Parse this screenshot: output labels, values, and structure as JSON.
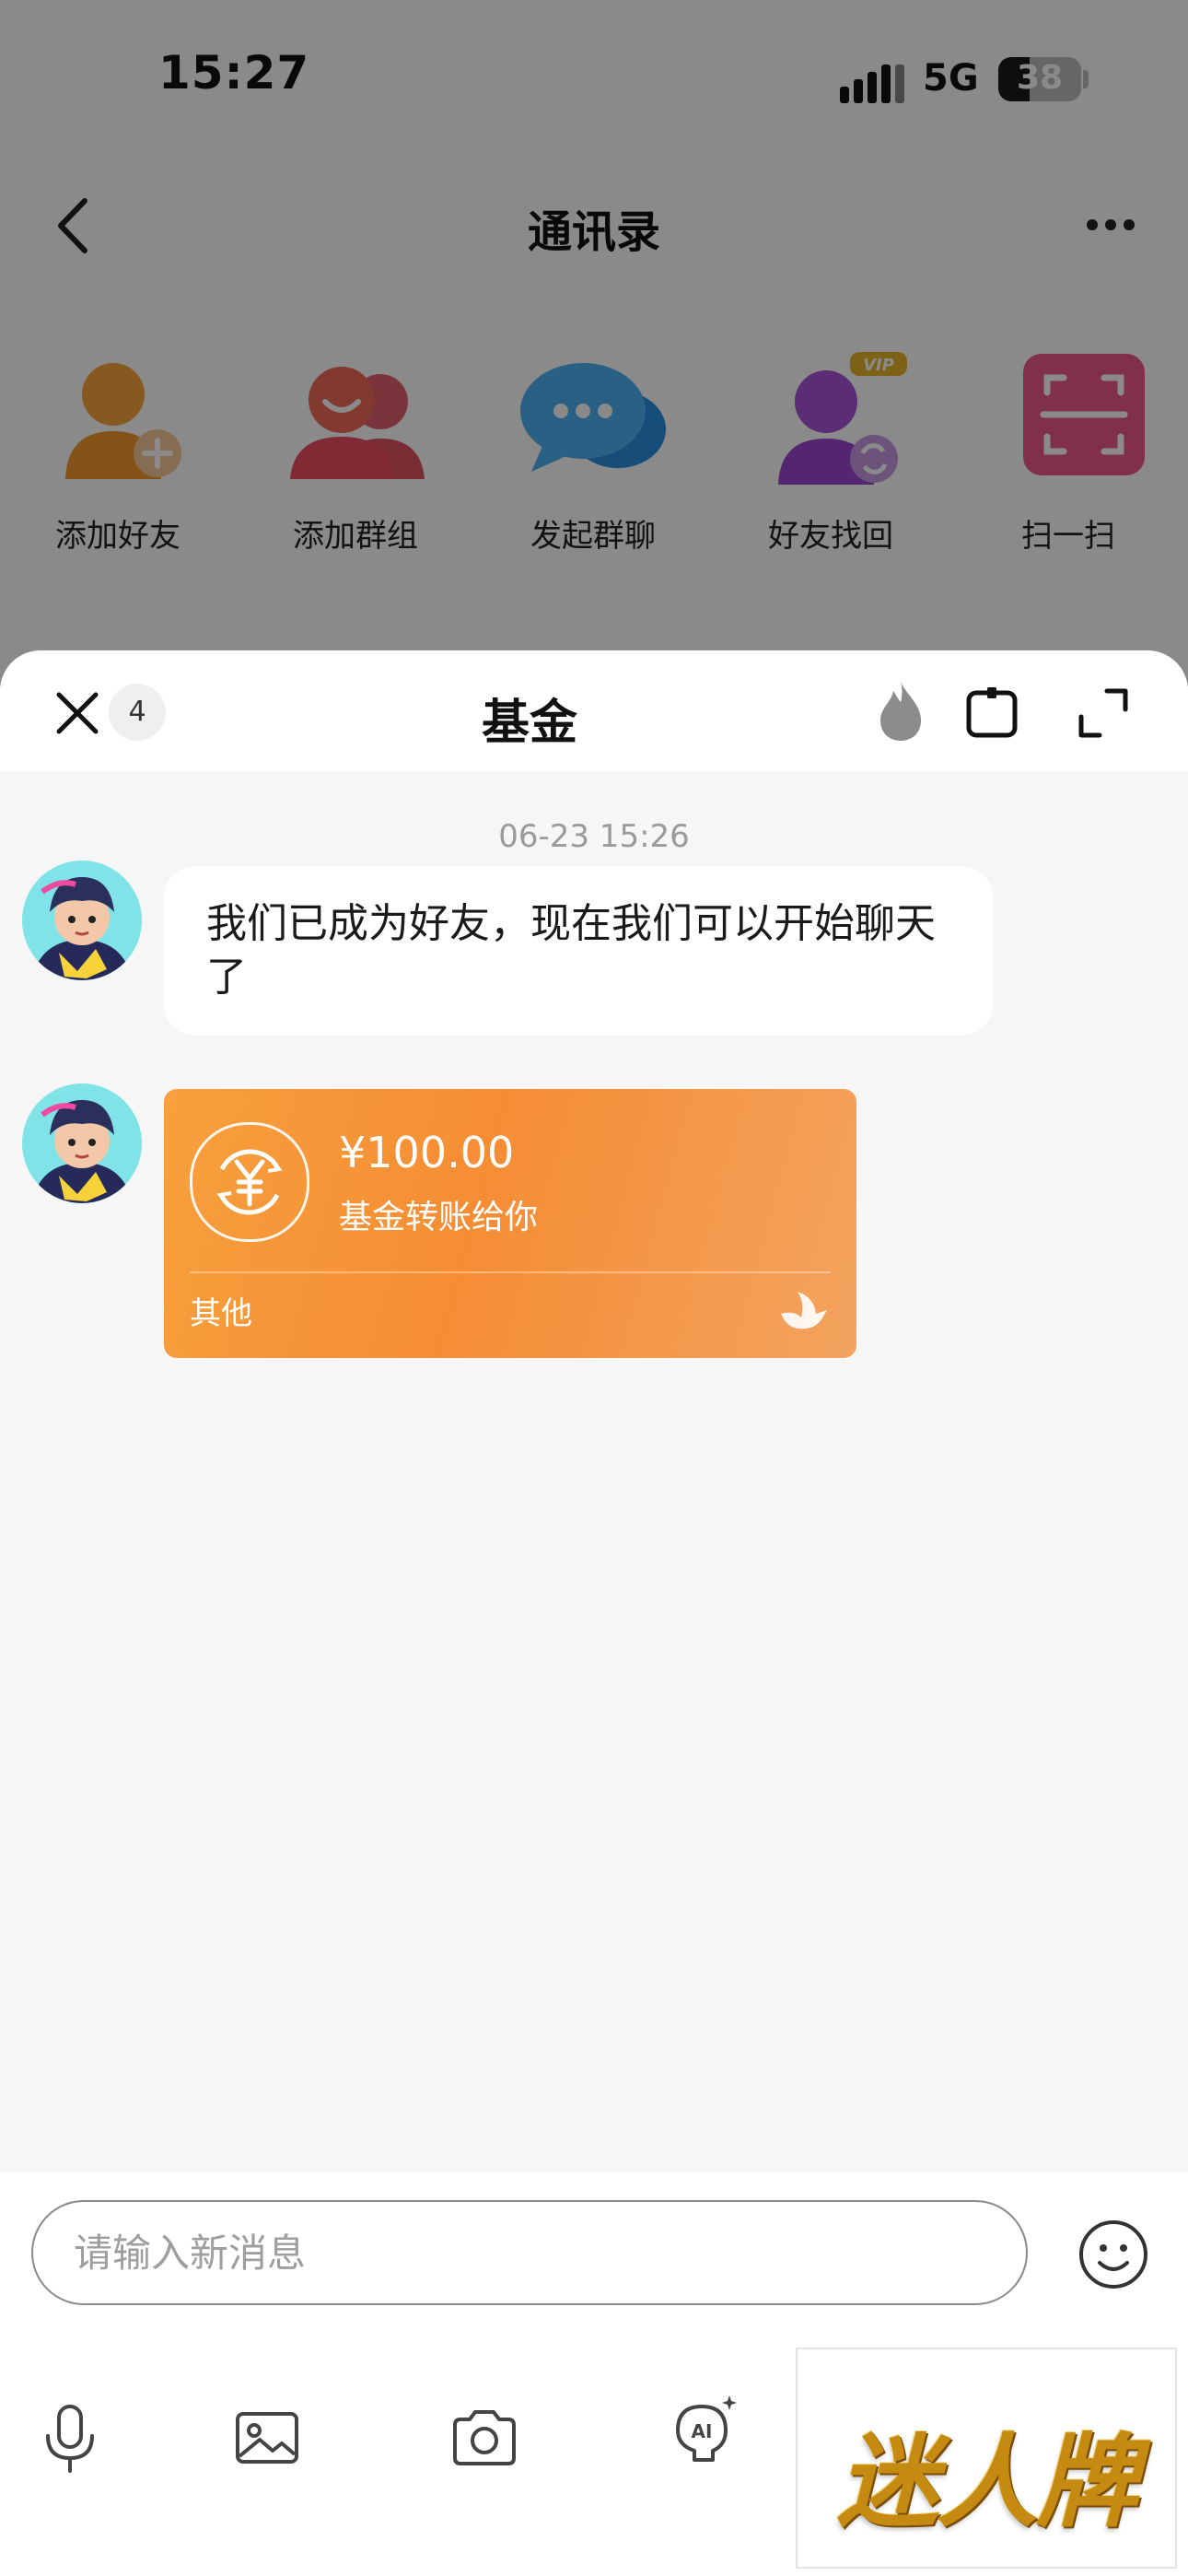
{
  "status_bar": {
    "time": "15:27",
    "network": "5G",
    "battery": "38"
  },
  "nav": {
    "title": "通讯录"
  },
  "quick_actions": [
    {
      "label": "添加好友",
      "icon": "add-friend-icon"
    },
    {
      "label": "添加群组",
      "icon": "add-group-icon"
    },
    {
      "label": "发起群聊",
      "icon": "start-group-chat-icon"
    },
    {
      "label": "好友找回",
      "icon": "friend-recover-icon",
      "badge": "VIP"
    },
    {
      "label": "扫一扫",
      "icon": "scan-icon"
    }
  ],
  "sheet": {
    "title": "基金",
    "unread_count": "4"
  },
  "chat": {
    "timestamp": "06-23 15:26",
    "messages": [
      {
        "type": "text",
        "text": "我们已成为好友，现在我们可以开始聊天了"
      },
      {
        "type": "transfer",
        "amount": "¥100.00",
        "description": "基金转账给你",
        "footer": "其他"
      }
    ]
  },
  "input": {
    "placeholder": "请输入新消息"
  },
  "toolbar": {
    "icons": [
      "microphone-icon",
      "image-icon",
      "camera-icon",
      "ai-assistant-icon"
    ]
  },
  "ad": {
    "text": "迷人牌"
  },
  "colors": {
    "transfer_orange": "#f58d34",
    "chat_bg": "#f6f6f6",
    "timestamp_gray": "#9a9a9a"
  }
}
